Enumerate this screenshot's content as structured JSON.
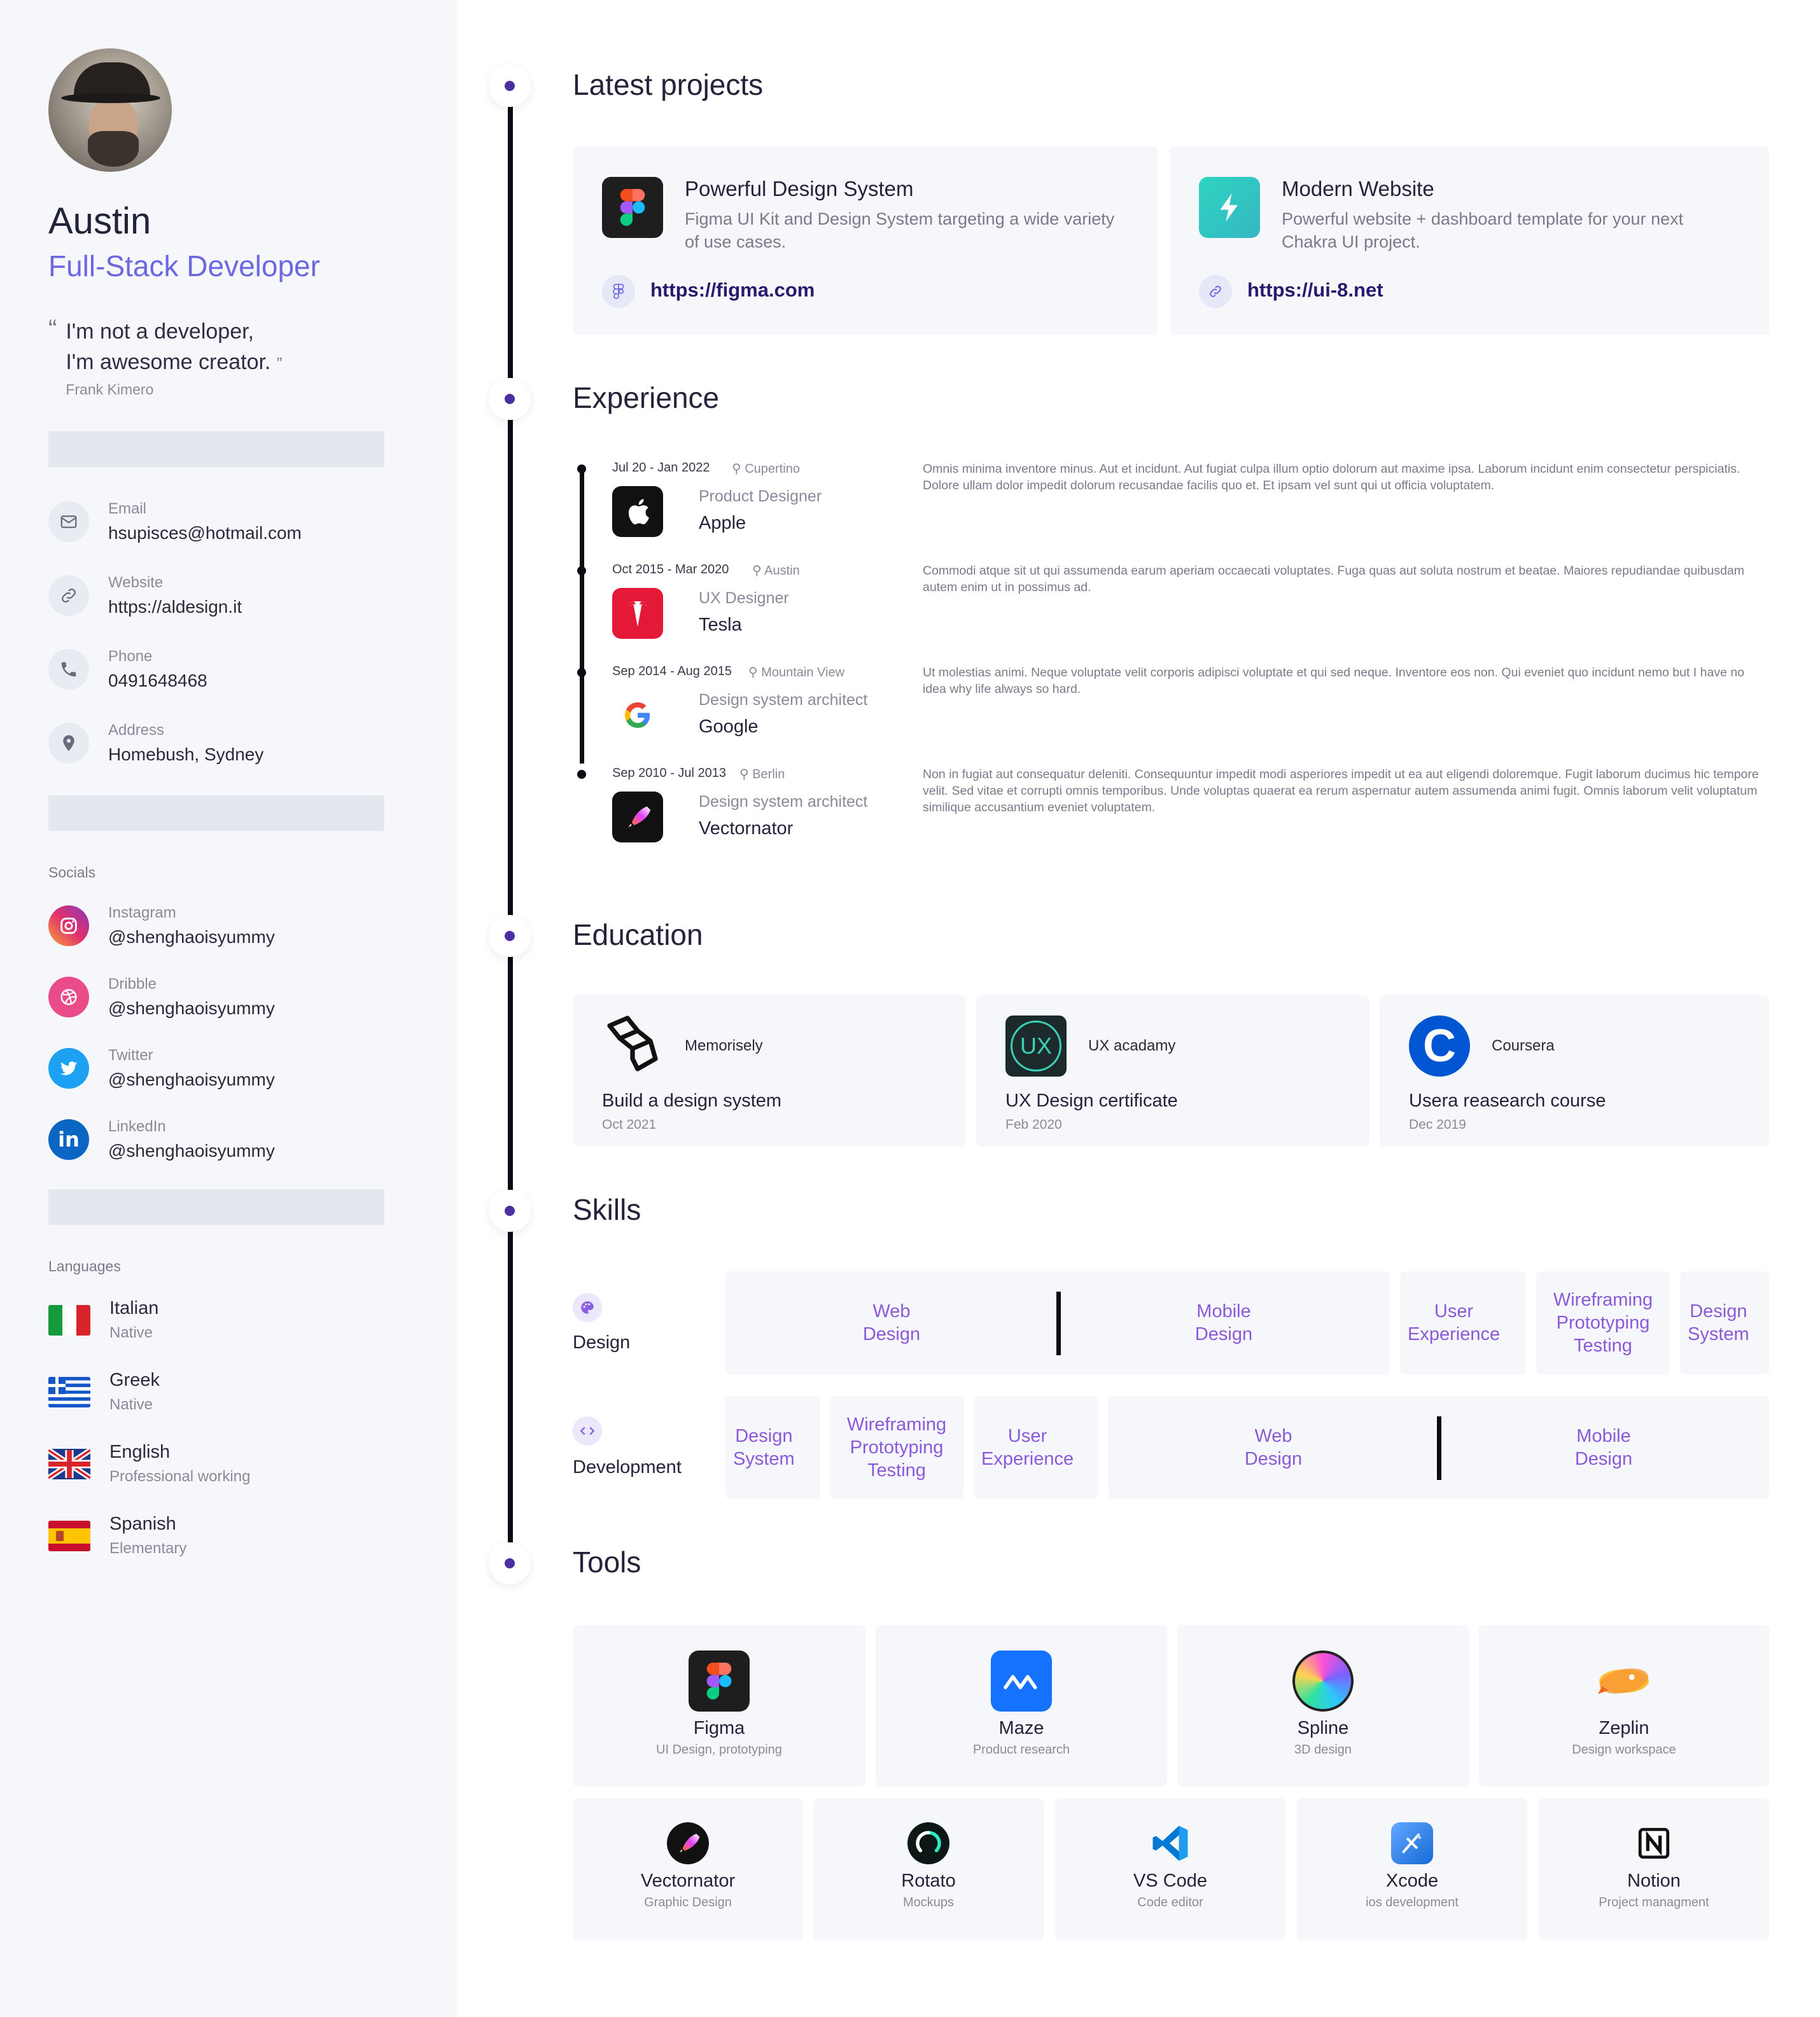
{
  "profile": {
    "name": "Austin",
    "role": "Full-Stack Developer",
    "quote_line1": "I'm not a developer,",
    "quote_line2": "I'm awesome creator.",
    "quote_open": "“",
    "quote_close": "”",
    "quote_author": "Frank Kimero"
  },
  "contact": [
    {
      "label": "Email",
      "value": "hsupisces@hotmail.com",
      "icon": "mail-icon"
    },
    {
      "label": "Website",
      "value": "https://aldesign.it",
      "icon": "link-icon"
    },
    {
      "label": "Phone",
      "value": "0491648468",
      "icon": "phone-icon"
    },
    {
      "label": "Address",
      "value": "Homebush, Sydney",
      "icon": "location-pin-icon"
    }
  ],
  "socials": {
    "title": "Socials",
    "items": [
      {
        "label": "Instagram",
        "value": "@shenghaoisyummy",
        "color": "#e1306c"
      },
      {
        "label": "Dribble",
        "value": "@shenghaoisyummy",
        "color": "#ea4c89"
      },
      {
        "label": "Twitter",
        "value": "@shenghaoisyummy",
        "color": "#1da1f2"
      },
      {
        "label": "LinkedIn",
        "value": "@shenghaoisyummy",
        "color": "#0a66c2"
      }
    ]
  },
  "languages": {
    "title": "Languages",
    "items": [
      {
        "name": "Italian",
        "level": "Native"
      },
      {
        "name": "Greek",
        "level": "Native"
      },
      {
        "name": "English",
        "level": "Professional working"
      },
      {
        "name": "Spanish",
        "level": "Elementary"
      }
    ]
  },
  "sections": {
    "projects": "Latest projects",
    "experience": "Experience",
    "education": "Education",
    "skills": "Skills",
    "tools": "Tools"
  },
  "projects": [
    {
      "title": "Powerful Design System",
      "desc": "Figma UI Kit and Design System targeting a wide variety of use cases.",
      "link": "https://figma.com"
    },
    {
      "title": "Modern Website",
      "desc": "Powerful website + dashboard template for your next Chakra UI project.",
      "link": "https://ui-8.net"
    }
  ],
  "experience": [
    {
      "date": "Jul 20 - Jan 2022",
      "location": "Cupertino",
      "role": "Product Designer",
      "company": "Apple",
      "desc": "Omnis minima inventore minus. Aut et incidunt. Aut fugiat culpa illum optio dolorum aut maxime ipsa. Laborum incidunt enim consectetur perspiciatis. Dolore ullam dolor impedit dolorum recusandae facilis quo et. Et ipsam vel sunt qui ut officia voluptatem."
    },
    {
      "date": "Oct 2015 - Mar 2020",
      "location": "Austin",
      "role": "UX Designer",
      "company": "Tesla",
      "desc": "Commodi atque sit ut qui assumenda earum aperiam occaecati voluptates. Fuga quas aut soluta nostrum et beatae. Maiores repudiandae quibusdam autem enim ut in possimus ad."
    },
    {
      "date": "Sep 2014 - Aug 2015",
      "location": "Mountain View",
      "role": "Design system architect",
      "company": "Google",
      "desc": "Ut molestias animi. Neque voluptate velit corporis adipisci voluptate et qui sed neque. Inventore eos non. Qui eveniet quo incidunt nemo but I have no idea why life always so hard."
    },
    {
      "date": "Sep 2010 - Jul 2013",
      "location": "Berlin",
      "role": "Design system architect",
      "company": "Vectornator",
      "desc": "Non in fugiat aut consequatur deleniti. Consequuntur impedit modi asperiores impedit ut ea aut eligendi doloremque. Fugit laborum ducimus hic tempore velit. Sed vitae et corrupti omnis temporibus. Unde voluptas quaerat ea rerum aspernatur autem assumenda animi fugit. Omnis laborum velit voluptatum similique accusantium eveniet voluptatem."
    }
  ],
  "education": [
    {
      "school": "Memorisely",
      "course": "Build a design system",
      "date": "Oct 2021"
    },
    {
      "school": "UX acadamy",
      "course": "UX Design certificate",
      "date": "Feb 2020",
      "logo_text": "UX"
    },
    {
      "school": "Coursera",
      "course": "Usera reasearch course",
      "date": "Dec 2019",
      "logo_text": "C"
    }
  ],
  "skills": {
    "design": {
      "label": "Design",
      "chips": [
        "Web\nDesign",
        "Mobile\nDesign",
        "User\nExperience",
        "Wireframing\nPrototyping\nTesting",
        "Design\nSystem"
      ]
    },
    "development": {
      "label": "Development",
      "chips": [
        "Design\nSystem",
        "Wireframing\nPrototyping\nTesting",
        "User\nExperience",
        "Web\nDesign",
        "Mobile\nDesign"
      ]
    }
  },
  "tools": [
    {
      "name": "Figma",
      "sub": "UI Design, prototyping"
    },
    {
      "name": "Maze",
      "sub": "Product research"
    },
    {
      "name": "Spline",
      "sub": "3D design"
    },
    {
      "name": "Zeplin",
      "sub": "Design workspace"
    },
    {
      "name": "Vectornator",
      "sub": "Graphic Design"
    },
    {
      "name": "Rotato",
      "sub": "Mockups"
    },
    {
      "name": "VS Code",
      "sub": "Code editor"
    },
    {
      "name": "Xcode",
      "sub": "ios development"
    },
    {
      "name": "Notion",
      "sub": "Project managment"
    }
  ]
}
